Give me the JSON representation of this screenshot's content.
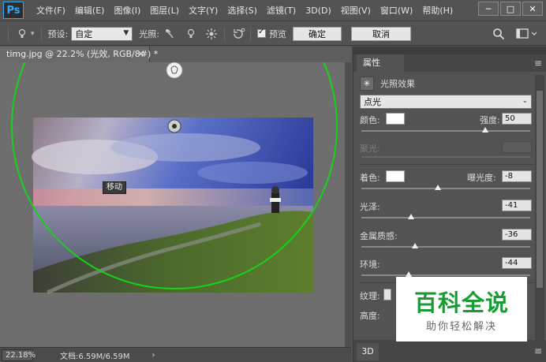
{
  "app": {
    "logo": "Ps"
  },
  "menu": [
    "文件(F)",
    "编辑(E)",
    "图像(I)",
    "图层(L)",
    "文字(Y)",
    "选择(S)",
    "滤镜(T)",
    "3D(D)",
    "视图(V)",
    "窗口(W)",
    "帮助(H)"
  ],
  "window_controls": {
    "minimize": "─",
    "maximize": "□",
    "close": "✕"
  },
  "options_bar": {
    "preset_label": "预设:",
    "preset_value": "自定",
    "light_label": "光照:",
    "preview_label": "预览",
    "preview_checked": true,
    "ok_label": "确定",
    "cancel_label": "取消"
  },
  "document": {
    "tab_title": "timg.jpg @ 22.2% (光效, RGB/8#) *",
    "tooltip": "移动",
    "zoom": "22.18%",
    "doc_size": "文档:6.59M/6.59M",
    "status_arrow": "›"
  },
  "properties": {
    "tab_label": "属性",
    "panel_title": "光照效果",
    "light_type": "点光",
    "color_label": "颜色:",
    "intensity_label": "强度:",
    "intensity_value": "50",
    "hotspot_label": "聚光:",
    "colorize_label": "着色:",
    "exposure_label": "曝光度:",
    "exposure_value": "-8",
    "gloss_label": "光泽:",
    "gloss_value": "-41",
    "metallic_label": "金属质感:",
    "metallic_value": "-36",
    "ambience_label": "环境:",
    "ambience_value": "-44",
    "texture_label": "纹理:",
    "height_label": "高度:",
    "bottom_tab": "3D"
  },
  "watermark": {
    "title": "百科全说",
    "subtitle": "助你轻松解决"
  },
  "colors": {
    "light_ring": "#16d21a",
    "ui_bg": "#535353",
    "watermark_green": "#1a9c35"
  }
}
